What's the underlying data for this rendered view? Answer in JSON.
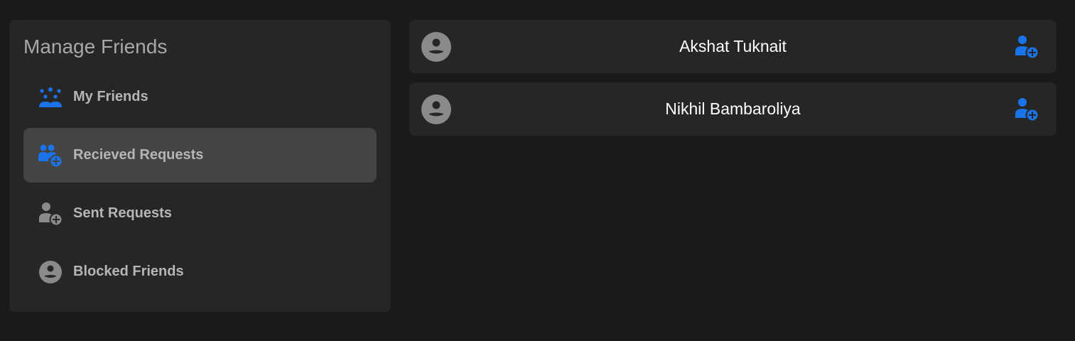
{
  "sidebar": {
    "title": "Manage Friends",
    "items": [
      {
        "label": "My Friends",
        "icon": "group-icon",
        "active": false
      },
      {
        "label": "Recieved Requests",
        "icon": "group-add-icon",
        "active": true
      },
      {
        "label": "Sent Requests",
        "icon": "person-add-icon",
        "active": false
      },
      {
        "label": "Blocked Friends",
        "icon": "account-circle-icon",
        "active": false
      }
    ]
  },
  "requests": [
    {
      "name": "Akshat Tuknait",
      "avatar_icon": "account-circle-icon",
      "action_icon": "person-add-icon"
    },
    {
      "name": "Nikhil Bambaroliya",
      "avatar_icon": "account-circle-icon",
      "action_icon": "person-add-icon"
    }
  ],
  "colors": {
    "background": "#1a1a1a",
    "panel": "#262626",
    "active_item": "#444444",
    "accent": "#1a73e8",
    "muted_text": "#b5b5b5",
    "icon_gray": "#8a8a8a"
  }
}
